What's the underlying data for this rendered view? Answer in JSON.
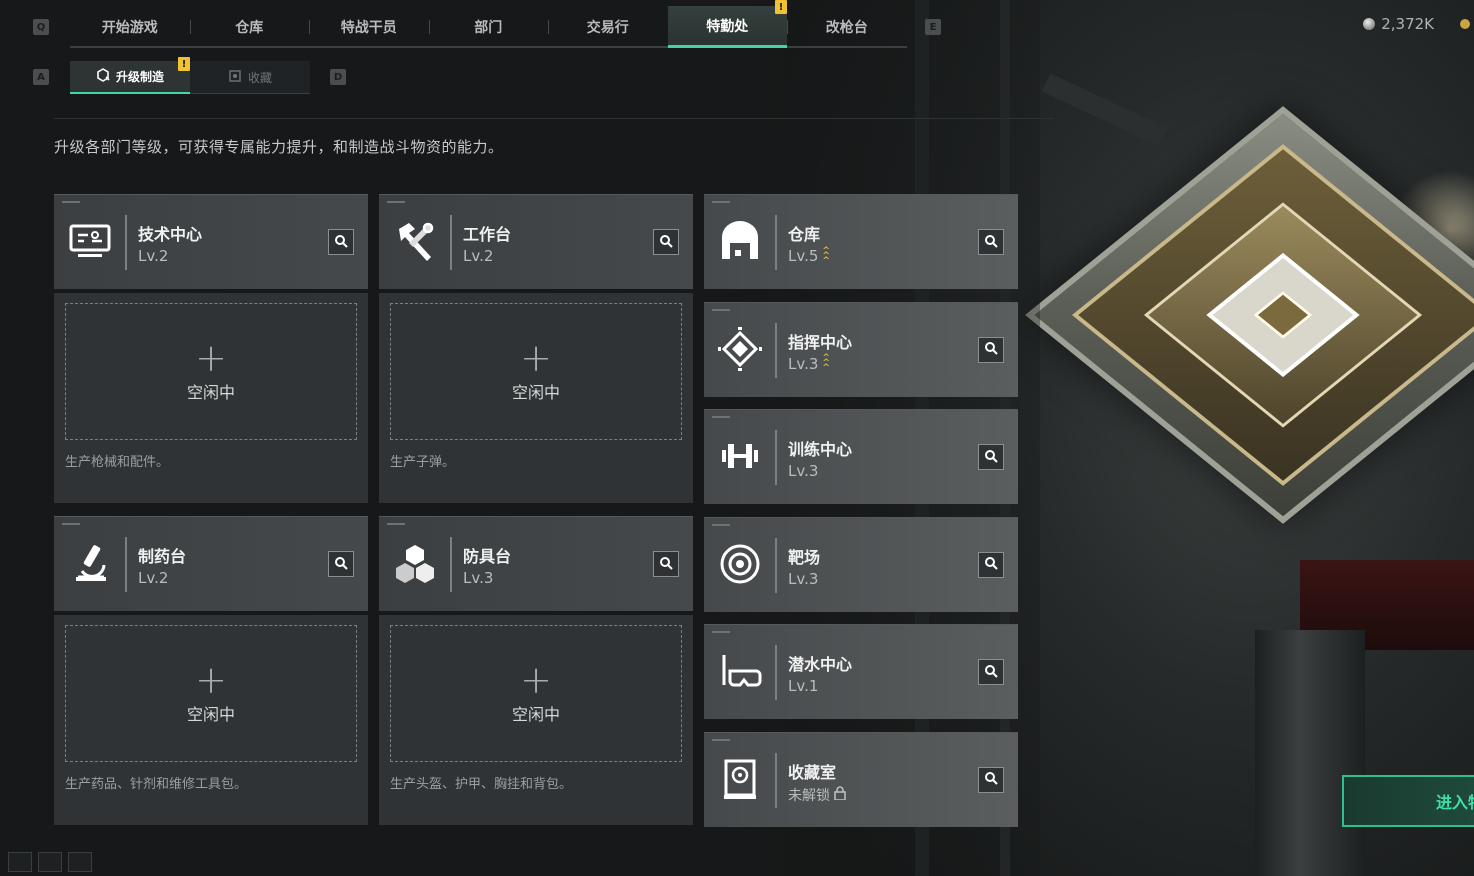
{
  "top_nav": {
    "key_left": "Q",
    "key_right": "E",
    "tabs": [
      {
        "label": "开始游戏",
        "active": false,
        "alert": false
      },
      {
        "label": "仓库",
        "active": false,
        "alert": false
      },
      {
        "label": "特战干员",
        "active": false,
        "alert": false
      },
      {
        "label": "部门",
        "active": false,
        "alert": false
      },
      {
        "label": "交易行",
        "active": false,
        "alert": false
      },
      {
        "label": "特勤处",
        "active": true,
        "alert": true
      },
      {
        "label": "改枪台",
        "active": false,
        "alert": false
      }
    ],
    "alert_mark": "!",
    "currency": "2,372K"
  },
  "sub_nav": {
    "key_left": "A",
    "key_right": "D",
    "tabs": [
      {
        "label": "升级制造",
        "icon": "upgrade-icon",
        "active": true,
        "alert": true
      },
      {
        "label": "收藏",
        "icon": "collection-icon",
        "active": false,
        "alert": false
      }
    ]
  },
  "description": "升级各部门等级，可获得专属能力提升，和制造战斗物资的能力。",
  "production_departments": [
    {
      "name": "技术中心",
      "level": "Lv.2",
      "icon": "tech-center-icon",
      "slot_label": "空闲中",
      "note": "生产枪械和配件。"
    },
    {
      "name": "工作台",
      "level": "Lv.2",
      "icon": "workbench-icon",
      "slot_label": "空闲中",
      "note": "生产子弹。"
    },
    {
      "name": "制药台",
      "level": "Lv.2",
      "icon": "pharmacy-icon",
      "slot_label": "空闲中",
      "note": "生产药品、针剂和维修工具包。"
    },
    {
      "name": "防具台",
      "level": "Lv.3",
      "icon": "armor-bench-icon",
      "slot_label": "空闲中",
      "note": "生产头盔、护甲、胸挂和背包。"
    }
  ],
  "other_departments": [
    {
      "name": "仓库",
      "level": "Lv.5",
      "icon": "warehouse-icon",
      "upgradable": true,
      "locked": false
    },
    {
      "name": "指挥中心",
      "level": "Lv.3",
      "icon": "command-center-icon",
      "upgradable": true,
      "locked": false
    },
    {
      "name": "训练中心",
      "level": "Lv.3",
      "icon": "training-center-icon",
      "upgradable": false,
      "locked": false
    },
    {
      "name": "靶场",
      "level": "Lv.3",
      "icon": "shooting-range-icon",
      "upgradable": false,
      "locked": false
    },
    {
      "name": "潜水中心",
      "level": "Lv.1",
      "icon": "diving-center-icon",
      "upgradable": false,
      "locked": false
    },
    {
      "name": "收藏室",
      "level": "未解锁",
      "icon": "collection-room-icon",
      "upgradable": false,
      "locked": true
    }
  ],
  "enter_button": "进入特",
  "colors": {
    "accent": "#3fd6a3",
    "alert": "#f1c232",
    "upgrade": "#e6b53a"
  }
}
